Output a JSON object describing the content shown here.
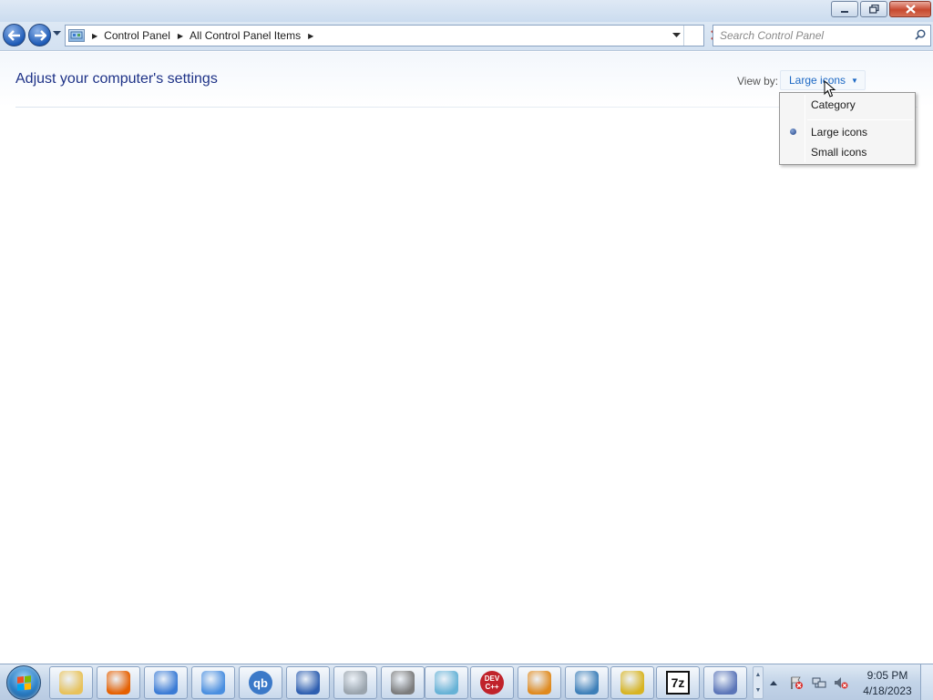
{
  "window": {
    "caption_buttons": {
      "minimize": "minimize-icon",
      "restore": "restore-icon",
      "close": "close-icon"
    }
  },
  "navbar": {
    "breadcrumbs": [
      "Control Panel",
      "All Control Panel Items"
    ],
    "search_placeholder": "Search Control Panel"
  },
  "content": {
    "title": "Adjust your computer's settings",
    "view_by_label": "View by:",
    "view_by_value": "Large icons"
  },
  "view_menu": {
    "items": [
      {
        "label": "Category",
        "selected": false
      },
      {
        "label": "Large icons",
        "selected": true
      },
      {
        "label": "Small icons",
        "selected": false
      }
    ]
  },
  "taskbar": {
    "pinned": [
      {
        "name": "windows-explorer-icon",
        "color": "#e8c25a"
      },
      {
        "name": "firefox-icon",
        "color": "#e66000"
      },
      {
        "name": "control-panel-icon",
        "color": "#3a7bd5"
      },
      {
        "name": "chromium-browser-icon",
        "color": "#4a8fe0"
      },
      {
        "name": "qbittorrent-icon",
        "label": "qb",
        "color": "#3b79c8"
      },
      {
        "name": "remote-desktop-icon",
        "color": "#2f5fb0"
      },
      {
        "name": "calculator-icon",
        "color": "#9aa4ad"
      },
      {
        "name": "fax-printer-icon",
        "color": "#7c7c7c"
      },
      {
        "name": "notes-icon",
        "color": "#66b2d6"
      },
      {
        "name": "dev-cpp-icon",
        "label": "DEV C++",
        "color": "#c0232b"
      },
      {
        "name": "search-tool-icon",
        "color": "#e08a1e"
      },
      {
        "name": "photo-viewer-icon",
        "color": "#3d7fb8"
      },
      {
        "name": "help-icon",
        "color": "#d8b422"
      },
      {
        "name": "7zip-icon",
        "label": "7z",
        "color": "#111111"
      },
      {
        "name": "font-tool-icon",
        "color": "#5b75b8"
      }
    ],
    "clock_time": "9:05 PM",
    "clock_date": "4/18/2023"
  }
}
